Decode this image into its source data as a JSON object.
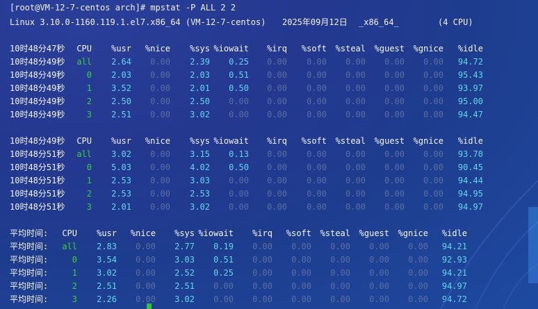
{
  "terminal": {
    "prompt_line": "[root@VM-12-7-centos arch]# mpstat -P ALL 2 2",
    "sysinfo": {
      "kernel": "Linux 3.10.0-1160.119.1.el7.x86_64 (VM-12-7-centos)",
      "date": "2025年09月12日",
      "arch": "_x86_64_",
      "cpus": "(4 CPU)"
    },
    "columns": [
      "CPU",
      "%usr",
      "%nice",
      "%sys",
      "%iowait",
      "%irq",
      "%soft",
      "%steal",
      "%guest",
      "%gnice",
      "%idle"
    ],
    "avg_columns": [
      "CPU",
      "%usr",
      "%nice",
      "%sys",
      "%iowait",
      "%irq",
      "%soft",
      "%steal",
      "%guest",
      "%gnice",
      "%idle"
    ],
    "blocks": [
      {
        "header_time": "10时48分47秒",
        "rows": [
          {
            "time": "10时48分49秒",
            "cpu": "all",
            "vals": [
              "2.64",
              "0.00",
              "2.39",
              "0.25",
              "0.00",
              "0.00",
              "0.00",
              "0.00",
              "0.00",
              "94.72"
            ]
          },
          {
            "time": "10时48分49秒",
            "cpu": "0",
            "vals": [
              "2.03",
              "0.00",
              "2.03",
              "0.51",
              "0.00",
              "0.00",
              "0.00",
              "0.00",
              "0.00",
              "95.43"
            ]
          },
          {
            "time": "10时48分49秒",
            "cpu": "1",
            "vals": [
              "3.52",
              "0.00",
              "2.01",
              "0.50",
              "0.00",
              "0.00",
              "0.00",
              "0.00",
              "0.00",
              "93.97"
            ]
          },
          {
            "time": "10时48分49秒",
            "cpu": "2",
            "vals": [
              "2.50",
              "0.00",
              "2.50",
              "0.00",
              "0.00",
              "0.00",
              "0.00",
              "0.00",
              "0.00",
              "95.00"
            ]
          },
          {
            "time": "10时48分49秒",
            "cpu": "3",
            "vals": [
              "2.51",
              "0.00",
              "3.02",
              "0.00",
              "0.00",
              "0.00",
              "0.00",
              "0.00",
              "0.00",
              "94.47"
            ]
          }
        ]
      },
      {
        "header_time": "10时48分49秒",
        "rows": [
          {
            "time": "10时48分51秒",
            "cpu": "all",
            "vals": [
              "3.02",
              "0.00",
              "3.15",
              "0.13",
              "0.00",
              "0.00",
              "0.00",
              "0.00",
              "0.00",
              "93.70"
            ]
          },
          {
            "time": "10时48分51秒",
            "cpu": "0",
            "vals": [
              "5.03",
              "0.00",
              "4.02",
              "0.50",
              "0.00",
              "0.00",
              "0.00",
              "0.00",
              "0.00",
              "90.45"
            ]
          },
          {
            "time": "10时48分51秒",
            "cpu": "1",
            "vals": [
              "2.53",
              "0.00",
              "3.03",
              "0.00",
              "0.00",
              "0.00",
              "0.00",
              "0.00",
              "0.00",
              "94.44"
            ]
          },
          {
            "time": "10时48分51秒",
            "cpu": "2",
            "vals": [
              "2.53",
              "0.00",
              "2.53",
              "0.00",
              "0.00",
              "0.00",
              "0.00",
              "0.00",
              "0.00",
              "94.95"
            ]
          },
          {
            "time": "10时48分51秒",
            "cpu": "3",
            "vals": [
              "2.01",
              "0.00",
              "3.02",
              "0.00",
              "0.00",
              "0.00",
              "0.00",
              "0.00",
              "0.00",
              "94.97"
            ]
          }
        ]
      }
    ],
    "average": {
      "label": "平均时间:",
      "rows": [
        {
          "cpu": "all",
          "vals": [
            "2.83",
            "0.00",
            "2.77",
            "0.19",
            "0.00",
            "0.00",
            "0.00",
            "0.00",
            "0.00",
            "94.21"
          ]
        },
        {
          "cpu": "0",
          "vals": [
            "3.54",
            "0.00",
            "3.03",
            "0.51",
            "0.00",
            "0.00",
            "0.00",
            "0.00",
            "0.00",
            "92.93"
          ]
        },
        {
          "cpu": "1",
          "vals": [
            "3.02",
            "0.00",
            "2.52",
            "0.25",
            "0.00",
            "0.00",
            "0.00",
            "0.00",
            "0.00",
            "94.21"
          ]
        },
        {
          "cpu": "2",
          "vals": [
            "2.51",
            "0.00",
            "2.51",
            "0.00",
            "0.00",
            "0.00",
            "0.00",
            "0.00",
            "0.00",
            "94.97"
          ]
        },
        {
          "cpu": "3",
          "vals": [
            "2.26",
            "0.00",
            "3.02",
            "0.00",
            "0.00",
            "0.00",
            "0.00",
            "0.00",
            "0.00",
            "94.72"
          ]
        }
      ]
    },
    "colors": {
      "background": "#233a92",
      "text": "#f2f2f2",
      "value": "#5fd9e8",
      "zero": "#5a6ea0",
      "cpu_index": "#37d436"
    }
  }
}
